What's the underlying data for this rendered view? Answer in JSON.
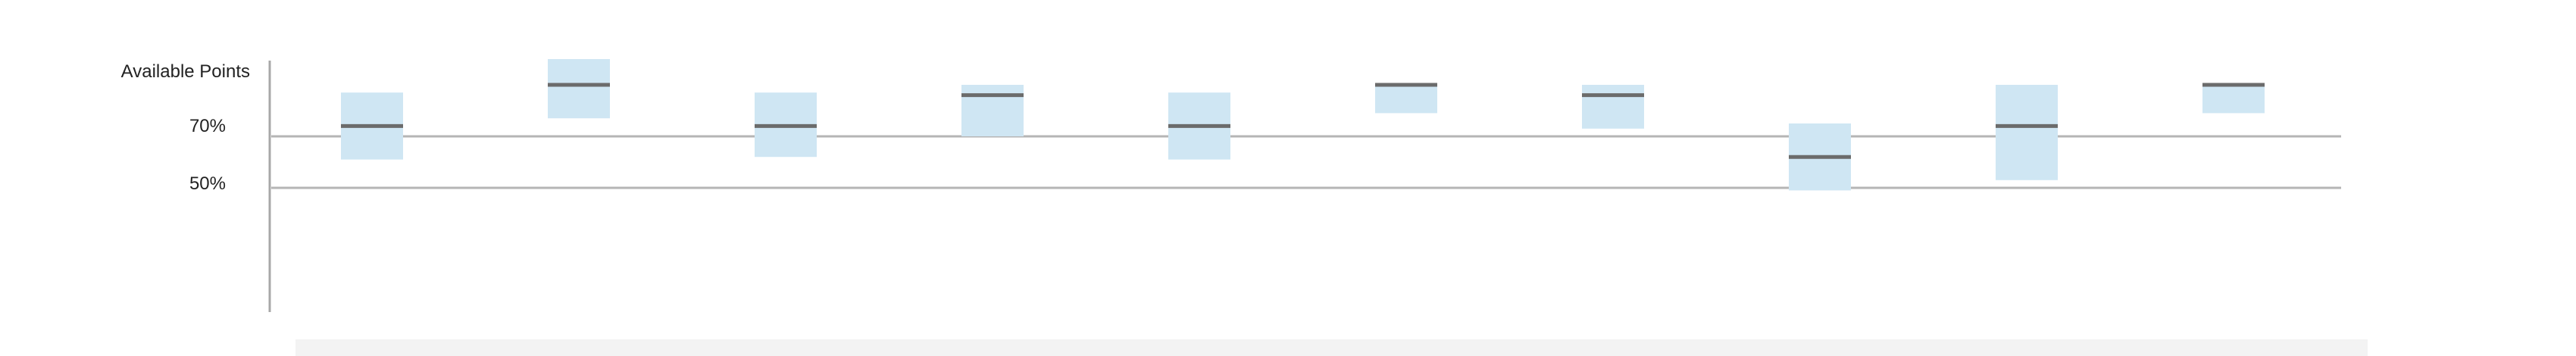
{
  "chart_data": {
    "type": "boxplot-range",
    "title": "",
    "xlabel": "",
    "ylabel": "",
    "y_tick_labels": [
      "Available Points",
      "70%",
      "50%"
    ],
    "reference_lines": [
      70,
      50
    ],
    "ylim": [
      -20,
      100
    ],
    "grid": false,
    "legend": "none",
    "series": [
      {
        "low": 61,
        "high": 87,
        "mid": 74
      },
      {
        "low": 77,
        "high": 100,
        "mid": 90
      },
      {
        "low": 62,
        "high": 87,
        "mid": 74
      },
      {
        "low": 70,
        "high": 90,
        "mid": 86
      },
      {
        "low": 61,
        "high": 87,
        "mid": 74
      },
      {
        "low": 79,
        "high": 90,
        "mid": 90
      },
      {
        "low": 73,
        "high": 90,
        "mid": 86
      },
      {
        "low": 49,
        "high": 75,
        "mid": 62
      },
      {
        "low": 53,
        "high": 90,
        "mid": 74
      },
      {
        "low": 79,
        "high": 90,
        "mid": 90
      }
    ],
    "colors": {
      "range_fill": "#cfe6f3",
      "median": "#6b6b6b",
      "reference_line": "#b5b5b5",
      "axis": "#a8a8a8",
      "footer": "#f3f3f3"
    }
  }
}
